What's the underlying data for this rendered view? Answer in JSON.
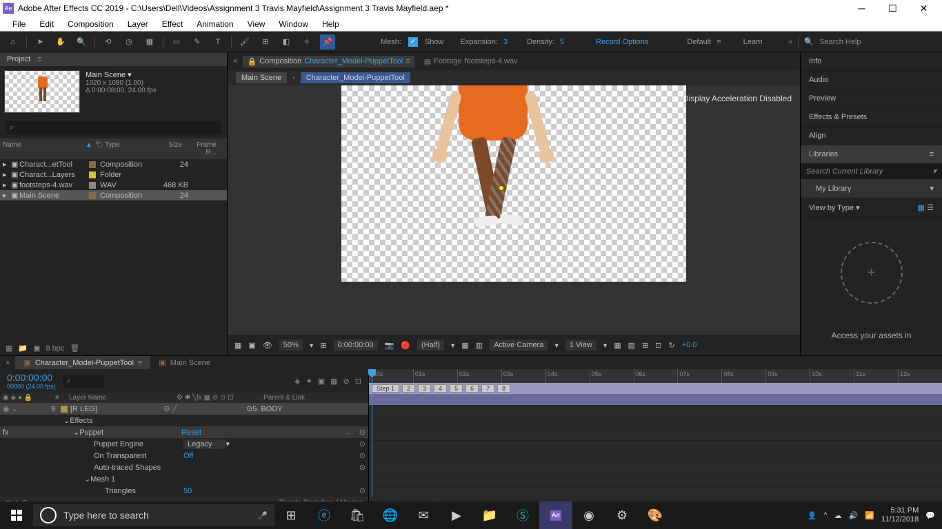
{
  "title": "Adobe After Effects CC 2019 - C:\\Users\\Dell\\Videos\\Assignment 3 Travis Mayfield\\Assignment 3 Travis Mayfield.aep *",
  "menu": [
    "File",
    "Edit",
    "Composition",
    "Layer",
    "Effect",
    "Animation",
    "View",
    "Window",
    "Help"
  ],
  "toolbar": {
    "mesh": "Mesh:",
    "show": "Show",
    "expansion": "Expansion:",
    "exp_val": "3",
    "density": "Density:",
    "den_val": "5",
    "record": "Record Options",
    "default": "Default",
    "learn": "Learn"
  },
  "searchHelp": "Search Help",
  "project": {
    "title": "Project",
    "compName": "Main Scene ▾",
    "res": "1920 x 1080 (1.00)",
    "dur": "Δ 0:00:08:00, 24.00 fps",
    "cols": {
      "name": "Name",
      "type": "Type",
      "size": "Size",
      "frame": "Frame R..."
    },
    "items": [
      {
        "name": "Charact...etTool",
        "type": "Composition",
        "size": "24",
        "color": "#8b6a4a"
      },
      {
        "name": "Charact...Layers",
        "type": "Folder",
        "size": "",
        "color": "#c9c932"
      },
      {
        "name": "footsteps-4.wav",
        "type": "WAV",
        "size": "468 KB",
        "color": "#888"
      },
      {
        "name": "Main Scene",
        "type": "Composition",
        "size": "24",
        "color": "#8b6a4a",
        "sel": true
      }
    ],
    "bpc": "8 bpc"
  },
  "comp": {
    "tabA_pre": "Composition",
    "tabA": "Character_Model-PuppetTool",
    "tabB_pre": "Footage",
    "tabB": "footsteps-4.wav",
    "crumb1": "Main Scene",
    "crumb2": "Character_Model-PuppetTool",
    "msg": "Display Acceleration Disabled",
    "zoom": "50%",
    "time": "0:00:00:00",
    "res": "(Half)",
    "cam": "Active Camera",
    "view": "1 View",
    "exp": "+0.0"
  },
  "right": {
    "panels": [
      "Info",
      "Audio",
      "Preview",
      "Effects & Presets",
      "Align"
    ],
    "lib": "Libraries",
    "libSearch": "Search Current Library",
    "myLib": "My Library",
    "vbt": "View by Type ▾",
    "msg": "Access your assets in"
  },
  "tl": {
    "tab1": "Character_Model-PuppetTool",
    "tab2": "Main Scene",
    "tc": "0:00:00:00",
    "tcSub": "00000 (24.00 fps)",
    "colHash": "#",
    "colLayer": "Layer Name",
    "colParent": "Parent & Link",
    "layerNum": "9",
    "layerName": "[R LEG]",
    "layerParent": "5. BODY",
    "effects": "Effects",
    "puppet": "Puppet",
    "reset": "Reset",
    "pEngine": "Puppet Engine",
    "pEngineVal": "Legacy",
    "onTrans": "On Transparent",
    "onTransVal": "Off",
    "autoTrace": "Auto-traced Shapes",
    "mesh": "Mesh 1",
    "tri": "Triangles",
    "triVal": "50",
    "toggle": "Toggle Switches / Modes",
    "ticks": [
      ":00s",
      "01s",
      "02s",
      "03s",
      "04s",
      "05s",
      "06s",
      "07s",
      "08s",
      "09s",
      "10s",
      "11s",
      "12s"
    ],
    "markers": [
      "Step 1",
      "2",
      "3",
      "4",
      "5",
      "6",
      "7",
      "8"
    ]
  },
  "taskbar": {
    "search": "Type here to search",
    "time": "5:31 PM",
    "date": "11/12/2018"
  }
}
